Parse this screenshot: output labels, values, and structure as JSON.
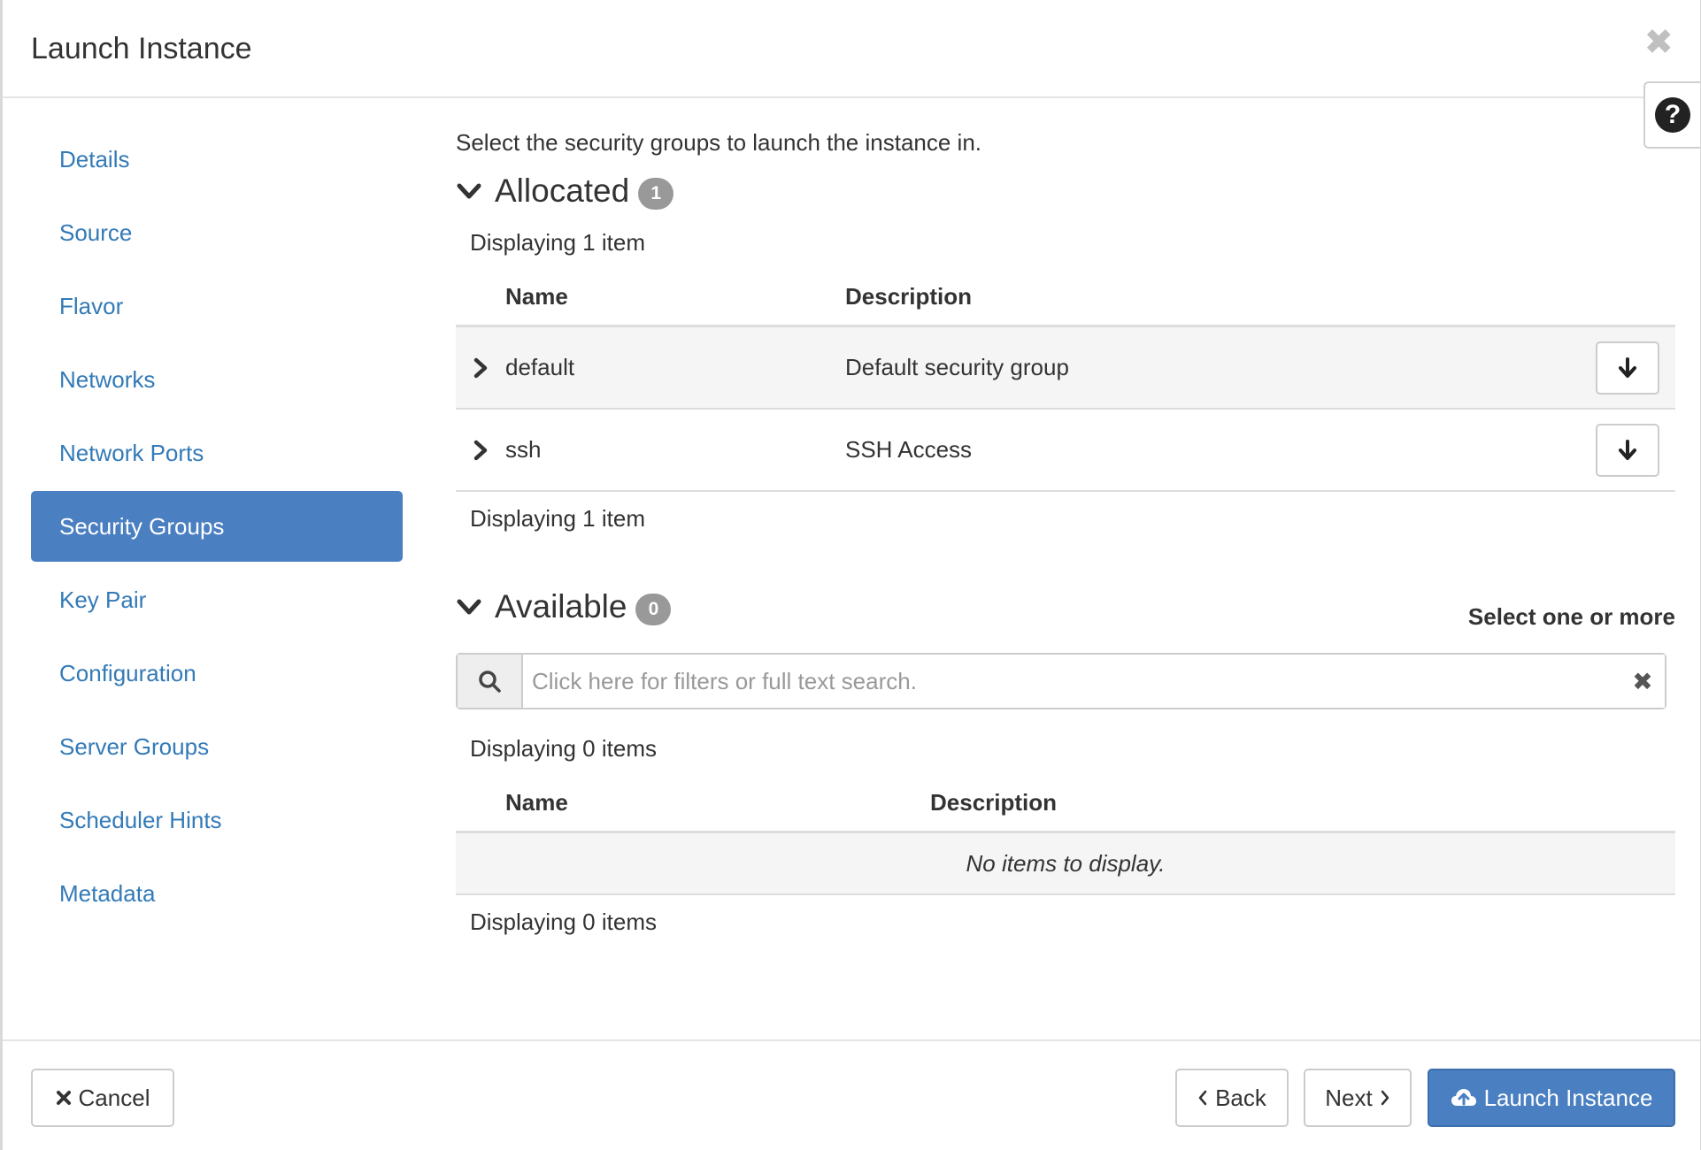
{
  "modal": {
    "title": "Launch Instance",
    "close_symbol": "✖",
    "help_symbol": "?"
  },
  "sidebar": {
    "items": [
      {
        "label": "Details"
      },
      {
        "label": "Source"
      },
      {
        "label": "Flavor"
      },
      {
        "label": "Networks"
      },
      {
        "label": "Network Ports"
      },
      {
        "label": "Security Groups",
        "active": true
      },
      {
        "label": "Key Pair"
      },
      {
        "label": "Configuration"
      },
      {
        "label": "Server Groups"
      },
      {
        "label": "Scheduler Hints"
      },
      {
        "label": "Metadata"
      }
    ]
  },
  "main": {
    "intro": "Select the security groups to launch the instance in.",
    "allocated": {
      "title": "Allocated",
      "badge": "1",
      "count_top": "Displaying 1 item",
      "count_bottom": "Displaying 1 item",
      "columns": [
        "Name",
        "Description"
      ],
      "rows": [
        {
          "name": "default",
          "description": "Default security group"
        },
        {
          "name": "ssh",
          "description": "SSH Access"
        }
      ]
    },
    "available": {
      "title": "Available",
      "badge": "0",
      "hint": "Select one or more",
      "search_placeholder": "Click here for filters or full text search.",
      "clear_symbol": "✖",
      "count_top": "Displaying 0 items",
      "count_bottom": "Displaying 0 items",
      "columns": [
        "Name",
        "Description"
      ],
      "empty": "No items to display."
    }
  },
  "footer": {
    "cancel": "Cancel",
    "back": "Back",
    "next": "Next",
    "launch": "Launch Instance"
  },
  "colors": {
    "accent": "#4a7fc1",
    "link": "#337ab7",
    "badge": "#999999"
  }
}
